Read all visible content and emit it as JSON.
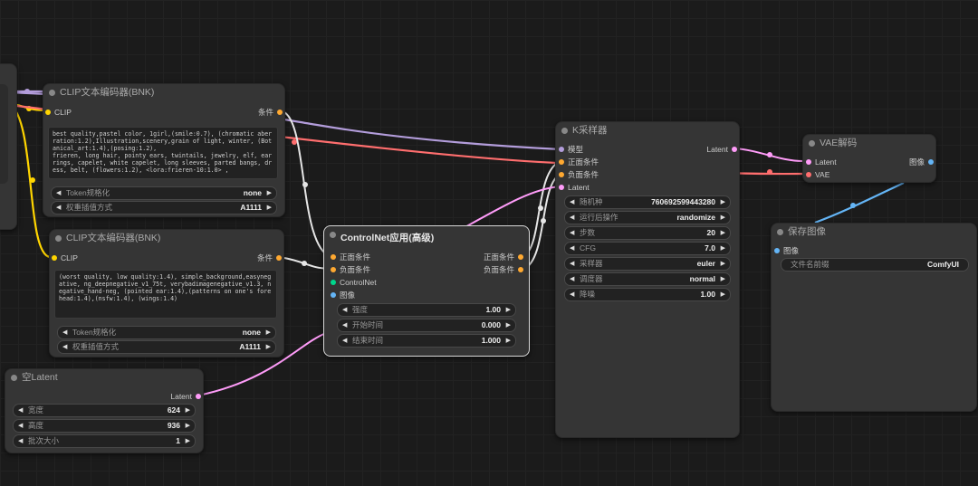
{
  "colors": {
    "clip": "#ffd500",
    "conditioning": "#ffa931",
    "latent": "#ff9cf9",
    "model": "#b39ddb",
    "vae": "#ff6e6e",
    "image": "#64b5f6",
    "controlnet": "#00d78d"
  },
  "clip1": {
    "title": "CLIP文本编码器(BNK)",
    "in_clip": "CLIP",
    "out_cond": "条件",
    "prompt": "best quality,pastel color, 1girl,(smile:0.7), (chromatic aberration:1.2),Illustration,scenery,grain of light, winter, (Botanical_art:1.4),(posing:1.2),\nfrieren, long hair, pointy ears, twintails, jewelry, elf, earrings, capelet, white capelet, long sleeves, parted bangs, dress, belt, (flowers:1.2), <lora:frieren-10:1.0> ,",
    "w1_label": "Token规格化",
    "w1_value": "none",
    "w2_label": "权重插值方式",
    "w2_value": "A1111"
  },
  "clip2": {
    "title": "CLIP文本编码器(BNK)",
    "in_clip": "CLIP",
    "out_cond": "条件",
    "prompt": "(worst quality, low quality:1.4), simple_background,easynegative, ng_deepnegative_v1_75t, verybadimagenegative_v1.3, negative_hand-neg, (pointed ear:1.4),(patterns on one's forehead:1.4),(nsfw:1.4), (wings:1.4)",
    "w1_label": "Token规格化",
    "w1_value": "none",
    "w2_label": "权重插值方式",
    "w2_value": "A1111"
  },
  "latent": {
    "title": "空Latent",
    "out": "Latent",
    "widgets": [
      {
        "label": "宽度",
        "value": "624"
      },
      {
        "label": "高度",
        "value": "936"
      },
      {
        "label": "批次大小",
        "value": "1"
      }
    ]
  },
  "controlnet": {
    "title": "ControlNet应用(高级)",
    "in_pos": "正面条件",
    "in_neg": "负面条件",
    "in_cn": "ControlNet",
    "in_img": "图像",
    "out_pos": "正面条件",
    "out_neg": "负面条件",
    "widgets": [
      {
        "label": "强度",
        "value": "1.00"
      },
      {
        "label": "开始时间",
        "value": "0.000"
      },
      {
        "label": "结束时间",
        "value": "1.000"
      }
    ]
  },
  "ksampler": {
    "title": "K采样器",
    "in_model": "模型",
    "in_pos": "正面条件",
    "in_neg": "负面条件",
    "in_latent": "Latent",
    "out_latent": "Latent",
    "widgets": [
      {
        "label": "随机种",
        "value": "760692599443280"
      },
      {
        "label": "运行后操作",
        "value": "randomize"
      },
      {
        "label": "步数",
        "value": "20"
      },
      {
        "label": "CFG",
        "value": "7.0"
      },
      {
        "label": "采样器",
        "value": "euler"
      },
      {
        "label": "调度器",
        "value": "normal"
      },
      {
        "label": "降噪",
        "value": "1.00"
      }
    ]
  },
  "vae": {
    "title": "VAE解码",
    "in_latent": "Latent",
    "in_vae": "VAE",
    "out_image": "图像"
  },
  "save": {
    "title": "保存图像",
    "in_image": "图像",
    "prefix_label": "文件名前缀",
    "prefix_value": "ComfyUI"
  }
}
